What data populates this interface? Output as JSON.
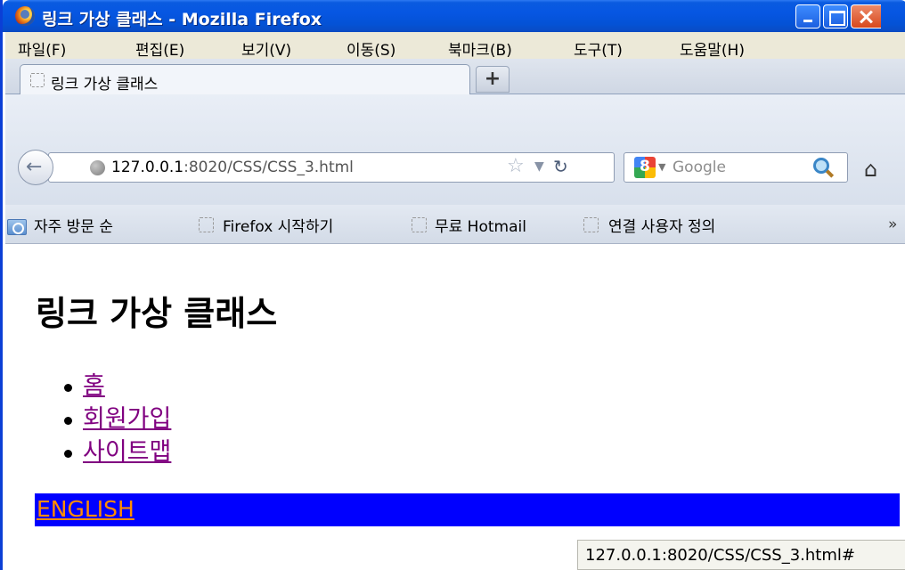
{
  "window": {
    "title": "링크 가상 클래스 - Mozilla Firefox"
  },
  "menu": [
    "파일(F)",
    "편집(E)",
    "보기(V)",
    "이동(S)",
    "북마크(B)",
    "도구(T)",
    "도움말(H)"
  ],
  "tab": {
    "label": "링크 가상 클래스",
    "new_tab_label": "+"
  },
  "address": {
    "host": "127.0.0.1",
    "path": ":8020/CSS/CSS_3.html"
  },
  "search": {
    "placeholder": "Google"
  },
  "bookmarks": [
    "자주 방문 순",
    "Firefox 시작하기",
    "무료 Hotmail",
    "연결 사용자 정의"
  ],
  "bookmarks_overflow": "»",
  "page": {
    "heading": "링크 가상 클래스",
    "links": [
      "홈",
      "회원가입",
      "사이트맵"
    ],
    "english_link": "ENGLISH"
  },
  "status": {
    "text": "127.0.0.1:8020/CSS/CSS_3.html#"
  },
  "colors": {
    "visited_link": "#800080",
    "english_bg": "#0000ff",
    "english_link": "#ff8c00"
  }
}
